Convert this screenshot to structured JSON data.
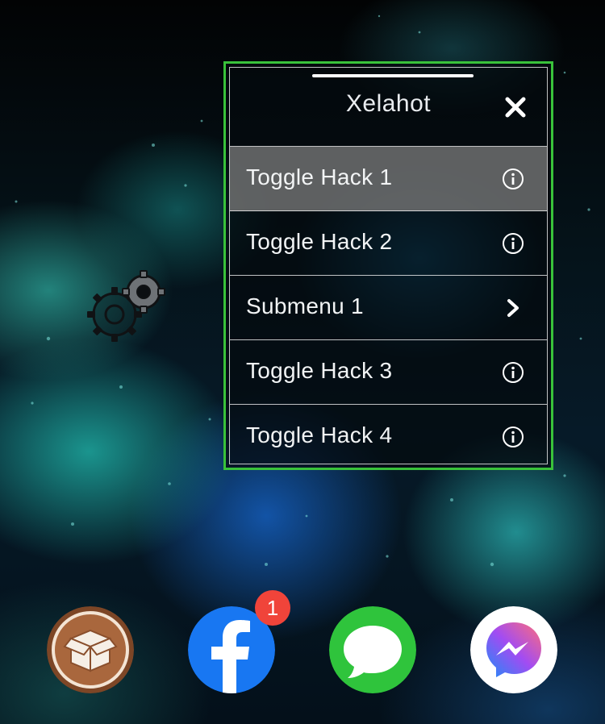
{
  "menu": {
    "title": "Xelahot",
    "close_icon": "close-icon",
    "border_color": "#39c23a",
    "items": [
      {
        "label": "Toggle Hack 1",
        "icon": "info-icon",
        "active": true
      },
      {
        "label": "Toggle Hack 2",
        "icon": "info-icon",
        "active": false
      },
      {
        "label": "Submenu 1",
        "icon": "chevron-right-icon",
        "active": false
      },
      {
        "label": "Toggle Hack 3",
        "icon": "info-icon",
        "active": false
      },
      {
        "label": "Toggle Hack 4",
        "icon": "info-icon",
        "active": false
      }
    ]
  },
  "floating_button": {
    "icon": "gears-icon"
  },
  "dock": {
    "apps": [
      {
        "name": "Cydia",
        "icon": "package-icon",
        "color": "#8a4f2c"
      },
      {
        "name": "Facebook",
        "icon": "facebook-icon",
        "color": "#1877f2",
        "badge": "1"
      },
      {
        "name": "Messages",
        "icon": "speech-bubble-icon",
        "color": "#2fc43c"
      },
      {
        "name": "Messenger",
        "icon": "messenger-icon",
        "color": "#a24cf2"
      }
    ]
  }
}
